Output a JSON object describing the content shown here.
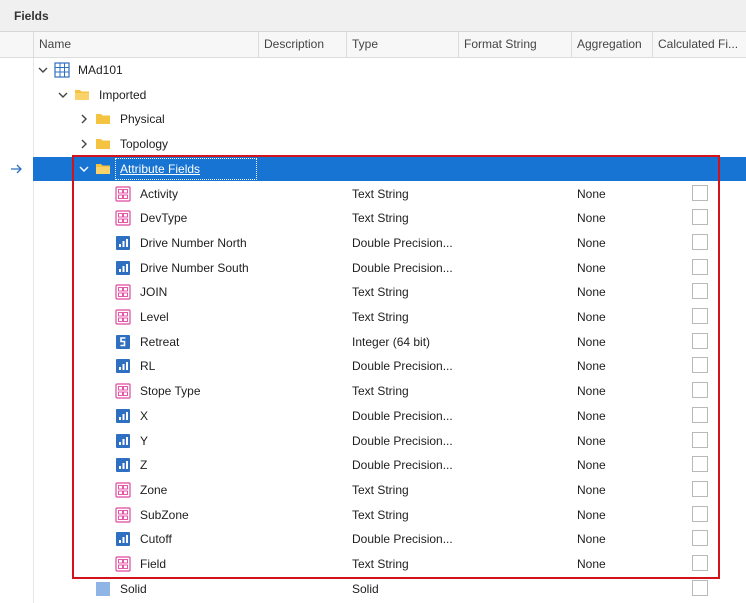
{
  "panel": {
    "title": "Fields"
  },
  "columns": [
    "Name",
    "Description",
    "Type",
    "Format String",
    "Aggregation",
    "Calculated Fi..."
  ],
  "tree": {
    "root": {
      "name": "MAd101"
    },
    "imported": {
      "name": "Imported"
    },
    "physical": {
      "name": "Physical"
    },
    "topology": {
      "name": "Topology"
    },
    "attribute": {
      "name": "Attribute Fields"
    },
    "solid": {
      "name": "Solid",
      "type": "Solid"
    }
  },
  "fields": [
    {
      "name": "Activity",
      "type": "Text String",
      "aggregation": "None",
      "icon": "text-field-icon"
    },
    {
      "name": "DevType",
      "type": "Text String",
      "aggregation": "None",
      "icon": "text-field-icon"
    },
    {
      "name": "Drive Number North",
      "type": "Double Precision...",
      "aggregation": "None",
      "icon": "double-field-icon"
    },
    {
      "name": "Drive Number South",
      "type": "Double Precision...",
      "aggregation": "None",
      "icon": "double-field-icon"
    },
    {
      "name": "JOIN",
      "type": "Text String",
      "aggregation": "None",
      "icon": "text-field-icon"
    },
    {
      "name": "Level",
      "type": "Text String",
      "aggregation": "None",
      "icon": "text-field-icon"
    },
    {
      "name": "Retreat",
      "type": "Integer (64 bit)",
      "aggregation": "None",
      "icon": "integer-field-icon"
    },
    {
      "name": "RL",
      "type": "Double Precision...",
      "aggregation": "None",
      "icon": "double-field-icon"
    },
    {
      "name": "Stope Type",
      "type": "Text String",
      "aggregation": "None",
      "icon": "text-field-icon"
    },
    {
      "name": "X",
      "type": "Double Precision...",
      "aggregation": "None",
      "icon": "double-field-icon"
    },
    {
      "name": "Y",
      "type": "Double Precision...",
      "aggregation": "None",
      "icon": "double-field-icon"
    },
    {
      "name": "Z",
      "type": "Double Precision...",
      "aggregation": "None",
      "icon": "double-field-icon"
    },
    {
      "name": "Zone",
      "type": "Text String",
      "aggregation": "None",
      "icon": "text-field-icon"
    },
    {
      "name": "SubZone",
      "type": "Text String",
      "aggregation": "None",
      "icon": "text-field-icon"
    },
    {
      "name": "Cutoff",
      "type": "Double Precision...",
      "aggregation": "None",
      "icon": "double-field-icon"
    },
    {
      "name": "Field",
      "type": "Text String",
      "aggregation": "None",
      "icon": "text-field-icon"
    }
  ],
  "colors": {
    "selection": "#1874d2",
    "highlight_border": "#d4121b",
    "folder": "#f5c342",
    "text_icon": "#e0479e",
    "numeric_icon": "#2f6fc1"
  }
}
